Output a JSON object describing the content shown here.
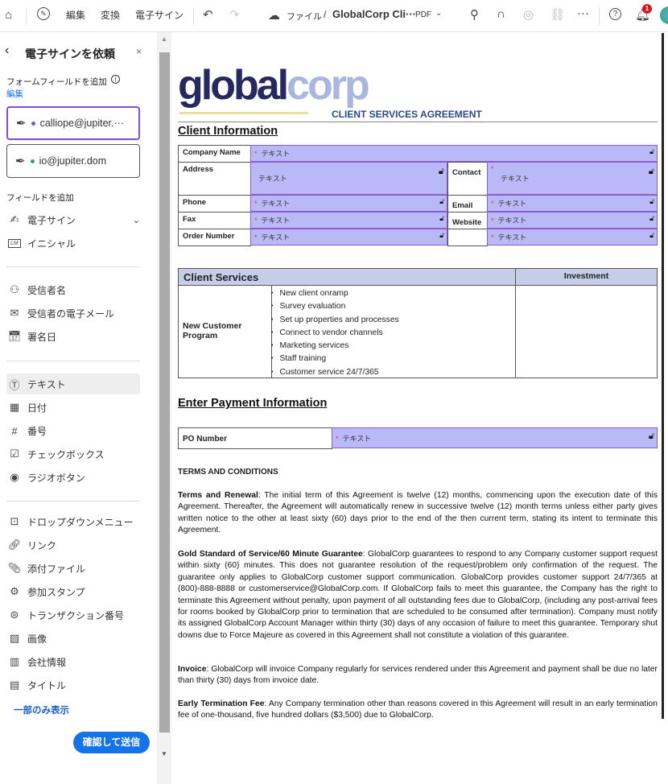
{
  "topbar": {
    "menu": [
      "編集",
      "変換",
      "電子サイン"
    ],
    "breadcrumb_root": "ファイル",
    "separator": "/",
    "filename": "GlobalCorp Cli···",
    "filetype": "PDF",
    "notification_count": "1"
  },
  "sidebar": {
    "title": "電子サインを依頼",
    "form_fields_label": "フォームフィールドを追加",
    "edit_link": "編集",
    "recipients": [
      {
        "email": "calliope@jupiter.···",
        "color": "#7b4fe0"
      },
      {
        "email": "io@jupiter.dom",
        "color": "#3aa35a"
      }
    ],
    "add_fields_label": "フィールドを追加",
    "group1": [
      {
        "icon": "signature-icon",
        "label": "電子サイン"
      },
      {
        "icon": "initials-icon",
        "label": "イニシャル"
      }
    ],
    "group2": [
      {
        "icon": "person-icon",
        "label": "受信者名"
      },
      {
        "icon": "mail-icon",
        "label": "受信者の電子メール"
      },
      {
        "icon": "calendar-icon",
        "label": "署名日"
      }
    ],
    "group3": [
      {
        "icon": "text-field-icon",
        "label": "テキスト"
      },
      {
        "icon": "date-icon",
        "label": "日付"
      },
      {
        "icon": "hash-icon",
        "label": "番号"
      },
      {
        "icon": "checkbox-icon",
        "label": "チェックボックス"
      },
      {
        "icon": "radio-icon",
        "label": "ラジオボタン"
      }
    ],
    "group4": [
      {
        "icon": "dropdown-icon",
        "label": "ドロップダウンメニュー"
      },
      {
        "icon": "link-icon",
        "label": "リンク"
      },
      {
        "icon": "attachment-icon",
        "label": "添付ファイル"
      },
      {
        "icon": "stamp-icon",
        "label": "参加スタンプ"
      },
      {
        "icon": "transaction-icon",
        "label": "トランザクション番号"
      },
      {
        "icon": "image-icon",
        "label": "画像"
      },
      {
        "icon": "company-icon",
        "label": "会社情報"
      },
      {
        "icon": "title-icon",
        "label": "タイトル"
      }
    ],
    "show_less": "一部のみ表示",
    "submit": "確認して送信"
  },
  "document": {
    "logo_text": "globalcorp",
    "doc_title": "CLIENT SERVICES AGREEMENT",
    "client_info_heading": "Client Information",
    "field_placeholder": "テキスト",
    "labels": {
      "company": "Company Name",
      "address": "Address",
      "contact": "Contact",
      "phone": "Phone",
      "email": "Email",
      "fax": "Fax",
      "website": "Website",
      "order": "Order Number"
    },
    "services_heading": "Client Services",
    "investment_heading": "Investment",
    "program_label": "New Customer Program",
    "services": [
      "New client onramp",
      "Survey evaluation",
      "Set up properties and processes",
      "Connect to vendor channels",
      "Marketing services",
      "Staff training",
      "Customer service 24/7/365"
    ],
    "payment_heading": "Enter Payment Information",
    "po_label": "PO Number",
    "terms_heading": "TERMS AND CONDITIONS",
    "terms": [
      {
        "title": "Terms and Renewal",
        "body": ": The initial term of this Agreement is twelve (12) months, commencing upon the execution date of this Agreement. Thereafter, the Agreement will automatically renew in successive twelve (12) month terms unless either party gives written notice to the other at least sixty (60) days prior to the end of the then current term, stating its intent to terminate this Agreement."
      },
      {
        "title": "Gold Standard of Service/60 Minute Guarantee",
        "body": ": GlobalCorp guarantees to respond to any Company customer support request within sixty (60) minutes. This does not guarantee resolution of the request/problem only confirmation of the request. The guarantee only applies to GlobalCorp customer support communication. GlobalCorp provides customer support 24/7/365 at (800)-888-8888 or customerservice@GlobalCorp.com.  If GlobalCorp fails to meet this guarantee, the Company has the right to terminate this Agreement without penalty, upon payment of all outstanding fees due to GlobalCorp, (including any post-arrival fees for rooms booked by GlobalCorp prior to termination that are scheduled to be consumed after termination). Company must notify its assigned GlobalCorp Account Manager within thirty (30) days of any occasion of failure to meet this guarantee.  Temporary shut downs due to Force Majeure as covered in this Agreement shall not constitute a violation of this guarantee."
      },
      {
        "title": "Invoice",
        "body": ": GlobalCorp will invoice Company regularly for services rendered under this Agreement and payment shall be due no later than thirty (30) days from invoice date."
      },
      {
        "title": "Early Termination Fee",
        "body": ": Any Company termination other than reasons covered in this Agreement will result in an early termination fee of one-thousand, five hundred dollars ($3,500) due to GlobalCorp."
      }
    ]
  },
  "colors": {
    "accent": "#1473e6",
    "field_fill": "#b9b9f7",
    "field_border": "#8a5ccf",
    "logo_dark": "#26285e",
    "logo_light": "#a9b6dd"
  }
}
